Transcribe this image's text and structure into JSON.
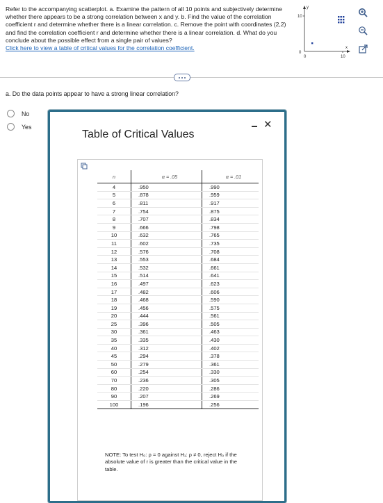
{
  "question": {
    "text": "Refer to the accompanying scatterplot. a. Examine the pattern of all 10 points and subjectively determine whether there appears to be a strong correlation between x and y. b. Find the value of the correlation coefficient r and determine whether there is a linear correlation. c. Remove the point with coordinates (2,2) and find the correlation coefficient r and determine whether there is a linear correlation. d. What do you conclude about the possible effect from a single pair of values?",
    "link": "Click here to view a table of critical values for the correlation coefficient."
  },
  "mini_plot": {
    "y_axis_label": "y",
    "y_tick": "10",
    "y_zero": "0",
    "x_zero": "0",
    "x_tick": "10",
    "x_axis_label": "x",
    "point_color": "#1f3f9a"
  },
  "side_icons": [
    "zoom-in-icon",
    "zoom-out-icon",
    "external-link-icon"
  ],
  "part_a": {
    "prompt": "a. Do the data points appear to have a strong linear correlation?",
    "options": [
      "No",
      "Yes"
    ]
  },
  "modal": {
    "title": "Table of Critical Values",
    "columns": {
      "n": "n",
      "a05": "α = .05",
      "a01": "α = .01"
    },
    "rows": [
      [
        "4",
        ".950",
        ".990"
      ],
      [
        "5",
        ".878",
        ".959"
      ],
      [
        "6",
        ".811",
        ".917"
      ],
      [
        "7",
        ".754",
        ".875"
      ],
      [
        "8",
        ".707",
        ".834"
      ],
      [
        "9",
        ".666",
        ".798"
      ],
      [
        "10",
        ".632",
        ".765"
      ],
      [
        "11",
        ".602",
        ".735"
      ],
      [
        "12",
        ".576",
        ".708"
      ],
      [
        "13",
        ".553",
        ".684"
      ],
      [
        "14",
        ".532",
        ".661"
      ],
      [
        "15",
        ".514",
        ".641"
      ],
      [
        "16",
        ".497",
        ".623"
      ],
      [
        "17",
        ".482",
        ".606"
      ],
      [
        "18",
        ".468",
        ".590"
      ],
      [
        "19",
        ".456",
        ".575"
      ],
      [
        "20",
        ".444",
        ".561"
      ],
      [
        "25",
        ".396",
        ".505"
      ],
      [
        "30",
        ".361",
        ".463"
      ],
      [
        "35",
        ".335",
        ".430"
      ],
      [
        "40",
        ".312",
        ".402"
      ],
      [
        "45",
        ".294",
        ".378"
      ],
      [
        "50",
        ".279",
        ".361"
      ],
      [
        "60",
        ".254",
        ".330"
      ],
      [
        "70",
        ".236",
        ".305"
      ],
      [
        "80",
        ".220",
        ".286"
      ],
      [
        "90",
        ".207",
        ".269"
      ],
      [
        "100",
        ".196",
        ".256"
      ]
    ],
    "note": "NOTE: To test H₀: ρ = 0 against H₁: ρ ≠ 0, reject H₀ if the absolute value of r is greater than the critical value in the table."
  },
  "colors": {
    "link": "#1a62b8",
    "modal_border": "#2c6e8a"
  }
}
